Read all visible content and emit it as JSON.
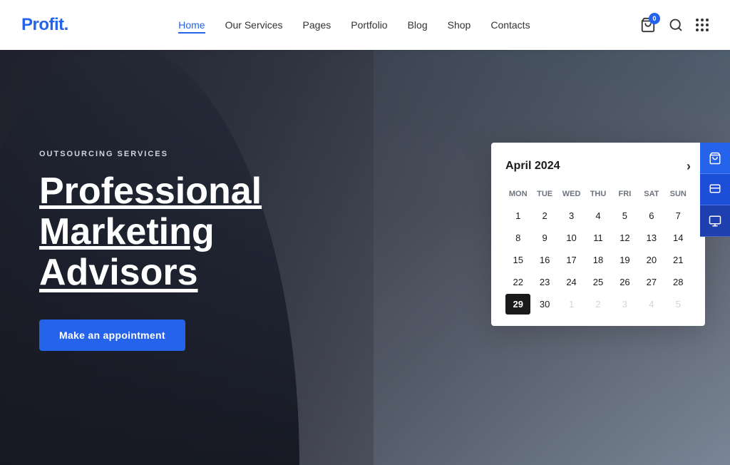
{
  "logo": {
    "text": "Profit",
    "dot": "."
  },
  "nav": {
    "items": [
      {
        "label": "Home",
        "active": true
      },
      {
        "label": "Our Services",
        "active": false
      },
      {
        "label": "Pages",
        "active": false
      },
      {
        "label": "Portfolio",
        "active": false
      },
      {
        "label": "Blog",
        "active": false
      },
      {
        "label": "Shop",
        "active": false
      },
      {
        "label": "Contacts",
        "active": false
      }
    ]
  },
  "cart": {
    "badge": "0"
  },
  "hero": {
    "subtitle": "OUTSOURCING SERVICES",
    "title_line1": "Professional",
    "title_line2": "Marketing",
    "title_line3": "Advisors",
    "cta_label": "Make an appointment"
  },
  "calendar": {
    "month_year": "April 2024",
    "day_headers": [
      "MON",
      "TUE",
      "WED",
      "THU",
      "FRI",
      "SAT",
      "SUN"
    ],
    "weeks": [
      [
        {
          "day": "",
          "other": true
        },
        {
          "day": "",
          "other": true
        },
        {
          "day": "",
          "other": true
        },
        {
          "day": "",
          "other": true
        },
        {
          "day": "",
          "other": true
        },
        {
          "day": "",
          "other": true
        },
        {
          "day": "",
          "other": true
        }
      ],
      [
        {
          "day": "1"
        },
        {
          "day": "2"
        },
        {
          "day": "3"
        },
        {
          "day": "4"
        },
        {
          "day": "5"
        },
        {
          "day": "6"
        },
        {
          "day": "7"
        }
      ],
      [
        {
          "day": "8"
        },
        {
          "day": "9"
        },
        {
          "day": "10"
        },
        {
          "day": "11"
        },
        {
          "day": "12"
        },
        {
          "day": "13"
        },
        {
          "day": "14"
        }
      ],
      [
        {
          "day": "15"
        },
        {
          "day": "16"
        },
        {
          "day": "17"
        },
        {
          "day": "18"
        },
        {
          "day": "19"
        },
        {
          "day": "20"
        },
        {
          "day": "21"
        }
      ],
      [
        {
          "day": "22"
        },
        {
          "day": "23"
        },
        {
          "day": "24"
        },
        {
          "day": "25"
        },
        {
          "day": "26"
        },
        {
          "day": "27"
        },
        {
          "day": "28"
        }
      ],
      [
        {
          "day": "29",
          "selected": true
        },
        {
          "day": "30"
        },
        {
          "day": "1",
          "other": true
        },
        {
          "day": "2",
          "other": true
        },
        {
          "day": "3",
          "other": true
        },
        {
          "day": "4",
          "other": true
        },
        {
          "day": "5",
          "other": true
        }
      ]
    ],
    "next_label": "›"
  }
}
